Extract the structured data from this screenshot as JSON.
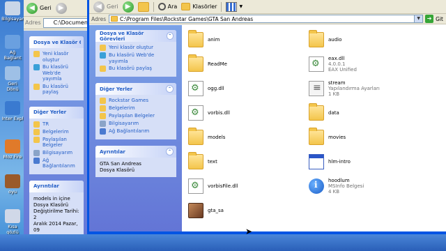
{
  "desktop": {
    "icons": [
      {
        "label": "Bilgisayar",
        "icon": "computer-icon"
      },
      {
        "label": "Ağ Bağlant",
        "icon": "network-icon"
      },
      {
        "label": "Geri Dönü",
        "icon": "recycle-bin-icon"
      },
      {
        "label": "Inter Expl",
        "icon": "ie-icon"
      },
      {
        "label": "Moz Fire",
        "icon": "firefox-icon"
      },
      {
        "label": "oyu",
        "icon": "game-icon"
      },
      {
        "label": "Kısa gözlü",
        "icon": "shortcut-icon"
      }
    ]
  },
  "back_window": {
    "back_label": "Geri",
    "address_label": "Adres",
    "address_value": "C:\\Documents",
    "tasks_title": "Dosya ve Klasör Görevleri",
    "tasks": [
      "Yeni klasör oluştur",
      "Bu klasörü Web'de yayımla",
      "Bu klasörü paylaş"
    ],
    "other_title": "Diğer Yerler",
    "other": [
      "TR",
      "Belgelerim",
      "Paylaşılan Belgeler",
      "Bilgisayarım",
      "Ağ Bağlantılarım"
    ],
    "details_title": "Ayrıntılar",
    "details_lines": [
      "models in içine",
      "Dosya Klasörü",
      "Değiştirilme Tarihi: 2",
      "Aralık 2014 Pazar, 09"
    ]
  },
  "toolbar": {
    "back_label": "Geri",
    "search_label": "Ara",
    "folders_label": "Klasörler"
  },
  "address": {
    "label": "Adres",
    "value": "C:\\Program Files\\Rockstar Games\\GTA San Andreas",
    "go_label": "Git"
  },
  "panel": {
    "tasks_title": "Dosya ve Klasör Görevleri",
    "tasks": [
      "Yeni klasör oluştur",
      "Bu klasörü Web'de yayımla",
      "Bu klasörü paylaş"
    ],
    "other_title": "Diğer Yerler",
    "other": [
      "Rockstar Games",
      "Belgelerim",
      "Paylaşılan Belgeler",
      "Bilgisayarım",
      "Ağ Bağlantılarım"
    ],
    "details_title": "Ayrıntılar",
    "details_name": "GTA San Andreas",
    "details_type": "Dosya Klasörü"
  },
  "files": [
    {
      "name": "anim",
      "type": "folder",
      "line2": "",
      "line3": ""
    },
    {
      "name": "audio",
      "type": "folder",
      "line2": "",
      "line3": ""
    },
    {
      "name": "ReadMe",
      "type": "folder",
      "line2": "",
      "line3": ""
    },
    {
      "name": "eax.dll",
      "type": "dll",
      "line2": "4.0.0.1",
      "line3": "EAX Unified"
    },
    {
      "name": "ogg.dll",
      "type": "dll",
      "line2": "",
      "line3": ""
    },
    {
      "name": "stream",
      "type": "cfg",
      "line2": "Yapılandırma Ayarları",
      "line3": "1 KB"
    },
    {
      "name": "vorbis.dll",
      "type": "dll",
      "line2": "",
      "line3": ""
    },
    {
      "name": "data",
      "type": "folder",
      "line2": "",
      "line3": ""
    },
    {
      "name": "models",
      "type": "folder",
      "line2": "",
      "line3": ""
    },
    {
      "name": "movies",
      "type": "folder",
      "line2": "",
      "line3": ""
    },
    {
      "name": "text",
      "type": "folder",
      "line2": "",
      "line3": ""
    },
    {
      "name": "hlm-intro",
      "type": "app-win",
      "line2": "",
      "line3": ""
    },
    {
      "name": "vorbisFile.dll",
      "type": "dll",
      "line2": "",
      "line3": ""
    },
    {
      "name": "hoodlum",
      "type": "info-ic",
      "line2": "MSInfo Belgesi",
      "line3": "4 KB"
    },
    {
      "name": "gta_sa",
      "type": "exe-ic",
      "line2": "",
      "line3": ""
    }
  ]
}
